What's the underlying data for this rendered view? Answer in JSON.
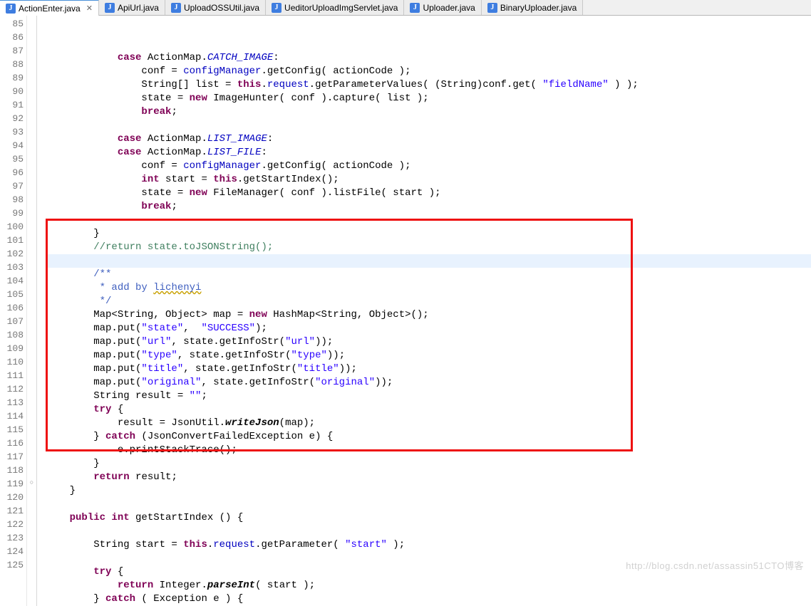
{
  "tabs": [
    {
      "label": "ActionEnter.java",
      "active": true
    },
    {
      "label": "ApiUrl.java",
      "active": false
    },
    {
      "label": "UploadOSSUtil.java",
      "active": false
    },
    {
      "label": "UeditorUploadImgServlet.java",
      "active": false
    },
    {
      "label": "Uploader.java",
      "active": false
    },
    {
      "label": "BinaryUploader.java",
      "active": false
    }
  ],
  "close_glyph": "✕",
  "gutter": {
    "start": 85,
    "end": 125
  },
  "highlight_box": {
    "top_line": 100,
    "bottom_line": 116
  },
  "cursor_line": 100,
  "watermark": "http://blog.csdn.net/assassin51CTO博客",
  "code_lines": [
    {
      "n": 85,
      "html": "            <span class='kw'>case</span> ActionMap.<span class='fldi'>CATCH_IMAGE</span>:"
    },
    {
      "n": 86,
      "html": "                conf = <span class='fld'>configManager</span>.getConfig( actionCode );"
    },
    {
      "n": 87,
      "html": "                String[] list = <span class='kw'>this</span>.<span class='fld'>request</span>.getParameterValues( (String)conf.get( <span class='str'>\"fieldName\"</span> ) );"
    },
    {
      "n": 88,
      "html": "                state = <span class='kw'>new</span> ImageHunter( conf ).capture( list );"
    },
    {
      "n": 89,
      "html": "                <span class='kw'>break</span>;"
    },
    {
      "n": 90,
      "html": "                "
    },
    {
      "n": 91,
      "html": "            <span class='kw'>case</span> ActionMap.<span class='fldi'>LIST_IMAGE</span>:"
    },
    {
      "n": 92,
      "html": "            <span class='kw'>case</span> ActionMap.<span class='fldi'>LIST_FILE</span>:"
    },
    {
      "n": 93,
      "html": "                conf = <span class='fld'>configManager</span>.getConfig( actionCode );"
    },
    {
      "n": 94,
      "html": "                <span class='kw'>int</span> start = <span class='kw'>this</span>.getStartIndex();"
    },
    {
      "n": 95,
      "html": "                state = <span class='kw'>new</span> FileManager( conf ).listFile( start );"
    },
    {
      "n": 96,
      "html": "                <span class='kw'>break</span>;"
    },
    {
      "n": 97,
      "html": "                "
    },
    {
      "n": 98,
      "html": "        }"
    },
    {
      "n": 99,
      "html": "        <span class='com'>//return state.toJSONString();</span>"
    },
    {
      "n": 100,
      "html": "        "
    },
    {
      "n": 101,
      "html": "        <span class='doc'>/**</span>"
    },
    {
      "n": 102,
      "html": "<span class='doc'>         * add by </span><span class='doc underline'>lichenyi</span>"
    },
    {
      "n": 103,
      "html": "<span class='doc'>         */</span>"
    },
    {
      "n": 104,
      "html": "        Map&lt;String, Object&gt; map = <span class='kw'>new</span> HashMap&lt;String, Object&gt;();"
    },
    {
      "n": 105,
      "html": "        map.put(<span class='str'>\"state\"</span>,  <span class='str'>\"SUCCESS\"</span>);"
    },
    {
      "n": 106,
      "html": "        map.put(<span class='str'>\"url\"</span>, state.getInfoStr(<span class='str'>\"url\"</span>));"
    },
    {
      "n": 107,
      "html": "        map.put(<span class='str'>\"type\"</span>, state.getInfoStr(<span class='str'>\"type\"</span>));"
    },
    {
      "n": 108,
      "html": "        map.put(<span class='str'>\"title\"</span>, state.getInfoStr(<span class='str'>\"title\"</span>));"
    },
    {
      "n": 109,
      "html": "        map.put(<span class='str'>\"original\"</span>, state.getInfoStr(<span class='str'>\"original\"</span>));"
    },
    {
      "n": 110,
      "html": "        String result = <span class='str'>\"\"</span>;"
    },
    {
      "n": 111,
      "html": "        <span class='kw'>try</span> {"
    },
    {
      "n": 112,
      "html": "            result = JsonUtil.<span class='sti'>writeJson</span>(map);"
    },
    {
      "n": 113,
      "html": "        } <span class='kw'>catch</span> (JsonConvertFailedException e) {"
    },
    {
      "n": 114,
      "html": "            e.printStackTrace();"
    },
    {
      "n": 115,
      "html": "        }"
    },
    {
      "n": 116,
      "html": "        <span class='kw'>return</span> result;"
    },
    {
      "n": 117,
      "html": "    }"
    },
    {
      "n": 118,
      "html": "    "
    },
    {
      "n": 119,
      "html": "    <span class='kw'>public int</span> getStartIndex () {"
    },
    {
      "n": 120,
      "html": "        "
    },
    {
      "n": 121,
      "html": "        String start = <span class='kw'>this</span>.<span class='fld'>request</span>.getParameter( <span class='str'>\"start\"</span> );"
    },
    {
      "n": 122,
      "html": "        "
    },
    {
      "n": 123,
      "html": "        <span class='kw'>try</span> {"
    },
    {
      "n": 124,
      "html": "            <span class='kw'>return</span> Integer.<span class='sti'>parseInt</span>( start );"
    },
    {
      "n": 125,
      "html": "        } <span class='kw'>catch</span> ( Exception e ) {"
    }
  ],
  "markers": {
    "119": "○"
  }
}
